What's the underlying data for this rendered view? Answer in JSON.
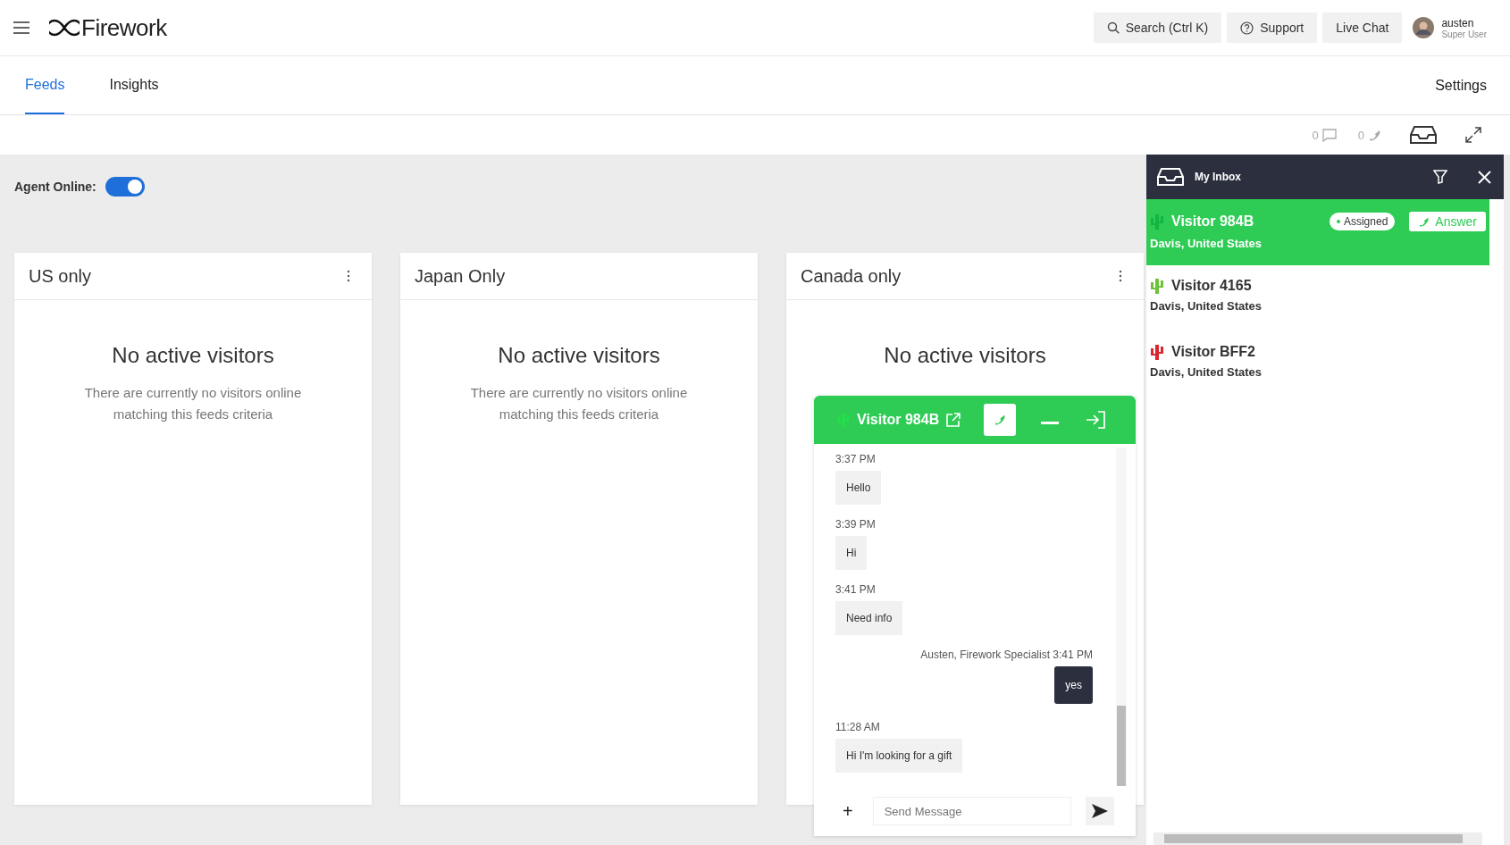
{
  "header": {
    "logo": "Firework",
    "search": "Search (Ctrl K)",
    "support": "Support",
    "live_chat": "Live Chat",
    "user": {
      "name": "austen",
      "role": "Super User"
    }
  },
  "tabs": [
    {
      "label": "Feeds",
      "selected": true
    },
    {
      "label": "Insights",
      "selected": false
    }
  ],
  "settings": "Settings",
  "toolbar": {
    "chat_count": "0",
    "call_count": "0"
  },
  "agent_online": {
    "label": "Agent Online:",
    "on": true
  },
  "feeds": [
    {
      "title": "US only",
      "has_menu": true,
      "empty_title": "No active visitors",
      "empty_text": "There are currently no visitors online matching this feeds criteria"
    },
    {
      "title": "Japan Only",
      "has_menu": false,
      "empty_title": "No active visitors",
      "empty_text": "There are currently no visitors online matching this feeds criteria"
    },
    {
      "title": "Canada only",
      "has_menu": true,
      "empty_title": "No active visitors"
    }
  ],
  "chat": {
    "visitor": "Visitor 984B",
    "messages": [
      {
        "kind": "visitor",
        "time": "3:37 PM",
        "text": "Hello"
      },
      {
        "kind": "visitor",
        "time": "3:39 PM",
        "text": "Hi"
      },
      {
        "kind": "visitor",
        "time": "3:41 PM",
        "text": "Need info"
      },
      {
        "kind": "agent",
        "time": "Austen, Firework Specialist 3:41 PM",
        "text": "yes"
      },
      {
        "kind": "visitor",
        "time": "11:28 AM",
        "text": "Hi I'm looking for a gift"
      }
    ],
    "input": {
      "placeholder": "Send Message"
    },
    "attach": "+"
  },
  "inbox": {
    "title": "My Inbox",
    "visitors": [
      {
        "name": "Visitor 984B",
        "location": "Davis, United States",
        "selected": true,
        "color": "#12b53f",
        "status": "Assigned",
        "action": "Answer"
      },
      {
        "name": "Visitor 4165",
        "location": "Davis, United States",
        "selected": false,
        "color": "#6cc33a"
      },
      {
        "name": "Visitor BFF2",
        "location": "Davis, United States",
        "selected": false,
        "color": "#d8262e"
      }
    ]
  }
}
